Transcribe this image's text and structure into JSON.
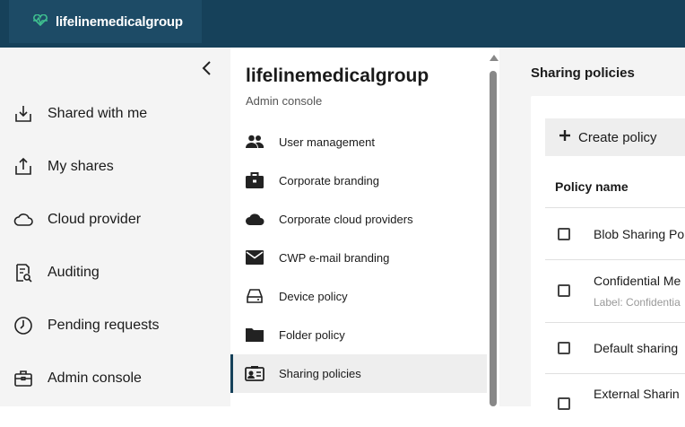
{
  "brand": {
    "name": "lifelinemedicalgroup"
  },
  "left_nav": {
    "collapse_icon": "chevron-left-icon",
    "items": [
      {
        "label": "Shared with me",
        "icon": "inbox-download-icon"
      },
      {
        "label": "My shares",
        "icon": "share-upload-icon"
      },
      {
        "label": "Cloud provider",
        "icon": "cloud-icon"
      },
      {
        "label": "Auditing",
        "icon": "audit-search-icon"
      },
      {
        "label": "Pending requests",
        "icon": "clock-icon"
      },
      {
        "label": "Admin console",
        "icon": "admin-briefcase-icon"
      }
    ]
  },
  "admin_panel": {
    "org_name": "lifelinemedicalgroup",
    "subtitle": "Admin console",
    "items": [
      {
        "label": "User management",
        "icon": "users-icon"
      },
      {
        "label": "Corporate branding",
        "icon": "briefcase-icon"
      },
      {
        "label": "Corporate cloud providers",
        "icon": "cloud-filled-icon"
      },
      {
        "label": "CWP e-mail branding",
        "icon": "envelope-icon"
      },
      {
        "label": "Device policy",
        "icon": "drive-icon"
      },
      {
        "label": "Folder policy",
        "icon": "folder-icon"
      },
      {
        "label": "Sharing policies",
        "icon": "sharing-policy-icon",
        "active": true
      }
    ]
  },
  "content": {
    "title": "Sharing policies",
    "create_button": "Create policy",
    "column_header": "Policy name",
    "rows": [
      {
        "name": "Blob Sharing Po",
        "sub": ""
      },
      {
        "name": "Confidential Me",
        "sub": "Label: Confidentia"
      },
      {
        "name": "Default sharing",
        "sub": ""
      },
      {
        "name": "External Sharin",
        "sub": ""
      }
    ]
  },
  "colors": {
    "topbar": "#16415a",
    "accent": "#16415a",
    "logo_icon": "#3fbf8f"
  }
}
